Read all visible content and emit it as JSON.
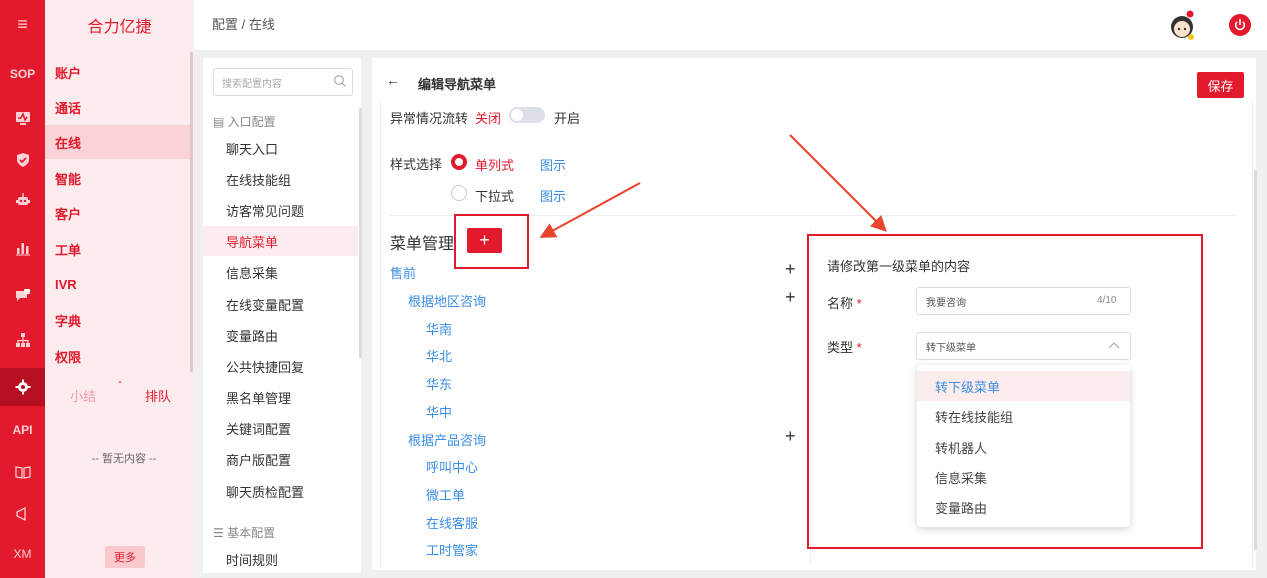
{
  "rail": [
    {
      "name": "menu-icon",
      "label": "≡"
    },
    {
      "name": "sop-item",
      "label": "SOP"
    },
    {
      "name": "monitor-icon",
      "label": ""
    },
    {
      "name": "shield-icon",
      "label": ""
    },
    {
      "name": "robot-icon",
      "label": ""
    },
    {
      "name": "chart-icon",
      "label": ""
    },
    {
      "name": "chat-icon",
      "label": ""
    },
    {
      "name": "org-icon",
      "label": ""
    },
    {
      "name": "gear-icon",
      "label": ""
    },
    {
      "name": "api-item",
      "label": "API"
    },
    {
      "name": "book-icon",
      "label": ""
    },
    {
      "name": "megaphone-icon",
      "label": ""
    },
    {
      "name": "xm-item",
      "label": "XM"
    }
  ],
  "brand": "合力亿捷",
  "nav": {
    "items": [
      "账户",
      "通话",
      "在线",
      "智能",
      "客户",
      "工单",
      "IVR",
      "字典",
      "权限"
    ],
    "active": "在线",
    "tab_summary": "小结",
    "tab_queue": "排队",
    "queue_mark": "-",
    "empty": "-- 暂无内容 --",
    "more": "更多"
  },
  "header": {
    "breadcrumb": "配置 / 在线"
  },
  "sub": {
    "search_placeholder": "搜索配置内容",
    "group1": "入口配置",
    "items": [
      "聊天入口",
      "在线技能组",
      "访客常见问题",
      "导航菜单",
      "信息采集",
      "在线变量配置",
      "变量路由",
      "公共快捷回复",
      "黑名单管理",
      "关键词配置",
      "商户版配置",
      "聊天质检配置"
    ],
    "active": "导航菜单",
    "group2": "基本配置",
    "items2": [
      "时间规则"
    ]
  },
  "main": {
    "back": "←",
    "title": "编辑导航菜单",
    "save": "保存",
    "exception_label": "异常情况流转",
    "off": "关闭",
    "on": "开启",
    "style_label": "样式选择",
    "style_single": "单列式",
    "style_dropdown": "下拉式",
    "preview": "图示",
    "menu_mgmt": "菜单管理",
    "add": "+",
    "plus": "+",
    "tree": [
      {
        "label": "售前",
        "level": 0
      },
      {
        "label": "根据地区咨询",
        "level": 1
      },
      {
        "label": "华南",
        "level": 2
      },
      {
        "label": "华北",
        "level": 2
      },
      {
        "label": "华东",
        "level": 2
      },
      {
        "label": "华中",
        "level": 2
      },
      {
        "label": "根据产品咨询",
        "level": 1
      },
      {
        "label": "呼叫中心",
        "level": 2
      },
      {
        "label": "微工单",
        "level": 2
      },
      {
        "label": "在线客服",
        "level": 2
      },
      {
        "label": "工时管家",
        "level": 2
      }
    ]
  },
  "panel": {
    "title": "请修改第一级菜单的内容",
    "name_label": "名称",
    "required": "*",
    "name_value": "我要咨询",
    "name_count": "4/10",
    "type_label": "类型",
    "type_value": "转下级菜单",
    "options": [
      "转下级菜单",
      "转在线技能组",
      "转机器人",
      "信息采集",
      "变量路由"
    ],
    "selected": "转下级菜单"
  },
  "colors": {
    "brand_red": "#e3192d",
    "link_blue": "#3a8ee6"
  }
}
